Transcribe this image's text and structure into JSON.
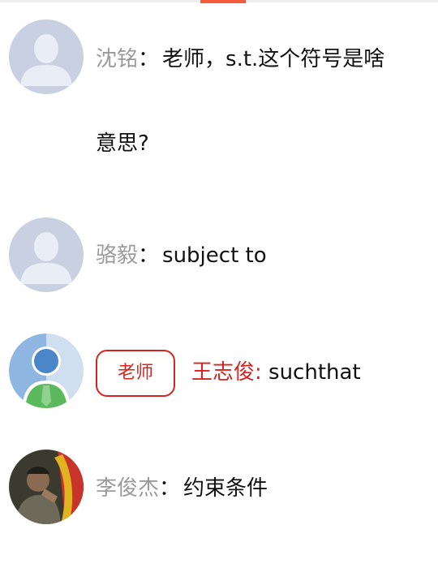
{
  "messages": [
    {
      "sender": "沈铭",
      "sep": "：",
      "text_line1": "老师，s.t.这个符号是啥",
      "text_line2": "意思?",
      "avatar": "default-avatar-icon"
    },
    {
      "sender": "骆毅",
      "sep": "：",
      "text": "subject to",
      "avatar": "default-avatar-icon"
    },
    {
      "badge": "老师",
      "sender": "王志俊:",
      "text": "suchthat",
      "avatar": "teacher-avatar-icon"
    },
    {
      "sender": "李俊杰",
      "sep": "：",
      "text": "约束条件",
      "avatar": "photo-avatar"
    }
  ],
  "colors": {
    "accent": "#f25a3b",
    "teacher": "#d9231e",
    "name_gray": "#9a9a9a",
    "avatar_bg": "#c8d0e2"
  }
}
